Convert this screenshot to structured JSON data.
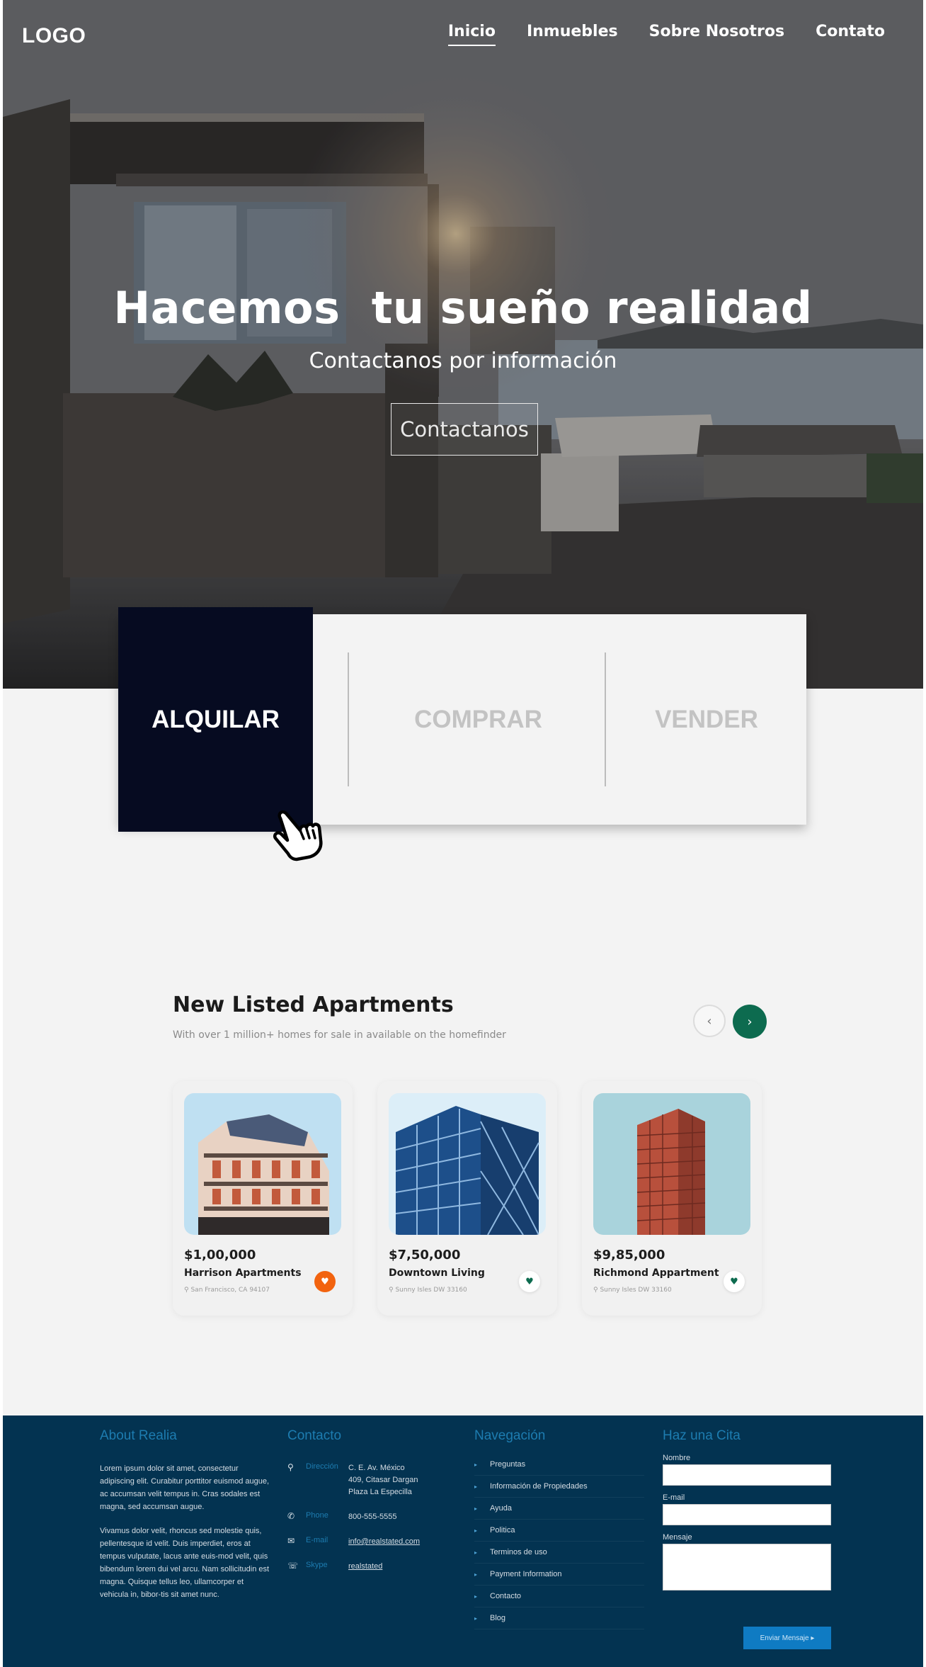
{
  "nav": {
    "logo": "LOGO",
    "links": [
      "Inicio",
      "Inmuebles",
      "Sobre Nosotros",
      "Contato"
    ]
  },
  "hero": {
    "title": "Hacemos  tu sueño realidad",
    "subtitle": "Contactanos por información",
    "button": "Contactanos"
  },
  "tabs": {
    "rent": "ALQUILAR",
    "buy": "COMPRAR",
    "sell": "VENDER"
  },
  "listings": {
    "title": "New Listed Apartments",
    "subtitle": "With over 1 million+ homes for sale in available on the homefinder",
    "prev_icon": "‹",
    "next_icon": "›",
    "cards": [
      {
        "price": "$1,00,000",
        "name": "Harrison Apartments",
        "location": "San Francisco, CA 94107",
        "favorite": true
      },
      {
        "price": "$7,50,000",
        "name": "Downtown Living",
        "location": "Sunny Isles DW 33160",
        "favorite": false
      },
      {
        "price": "$9,85,000",
        "name": "Richmond Appartment",
        "location": "Sunny Isles DW 33160",
        "favorite": false
      }
    ],
    "heart_glyph": "♥",
    "pin_glyph": "⚲"
  },
  "footer": {
    "about": {
      "heading": "About Realia",
      "para1": "Lorem ipsum dolor sit amet, consectetur adipiscing elit. Curabitur porttitor euismod augue, ac accumsan velit tempus in. Cras sodales est magna, sed accumsan augue.",
      "para2": "Vivamus dolor velit, rhoncus sed molestie quis, pellentesque id velit. Duis imperdiet, eros at tempus vulputate, lacus ante euis-mod velit, quis bibendum lorem dui vel arcu. Nam sollicitudin est magna. Quisque tellus leo, ullamcorper et vehicula in, bibor-tis sit amet nunc."
    },
    "contact": {
      "heading": "Contacto",
      "rows": [
        {
          "icon": "⚲",
          "label": "Dirección",
          "value": "C. E. Av. México\n409, Citasar Dargan\nPlaza La Especilla"
        },
        {
          "icon": "✆",
          "label": "Phone",
          "value": "800-555-5555"
        },
        {
          "icon": "✉",
          "label": "E-mail",
          "value": "info@realstated.com"
        },
        {
          "icon": "☏",
          "label": "Skype",
          "value": "realstated"
        }
      ]
    },
    "navigation": {
      "heading": "Navegación",
      "items": [
        "Preguntas",
        "Información de Propiedades",
        "Ayuda",
        "Politica",
        "Terminos de uso",
        "Payment Information",
        "Contacto",
        "Blog"
      ],
      "bullet": "▸"
    },
    "appointment": {
      "heading": "Haz una Cita",
      "name_label": "Nombre",
      "email_label": "E-mail",
      "message_label": "Mensaje",
      "submit": "Enviar Mensaje  ▸"
    }
  },
  "colors": {
    "tab_active": "#060b21",
    "next_button": "#0d6b4f",
    "favorite": "#f2630f",
    "footer_bg": "#033351",
    "footer_heading": "#1d7cb0"
  }
}
